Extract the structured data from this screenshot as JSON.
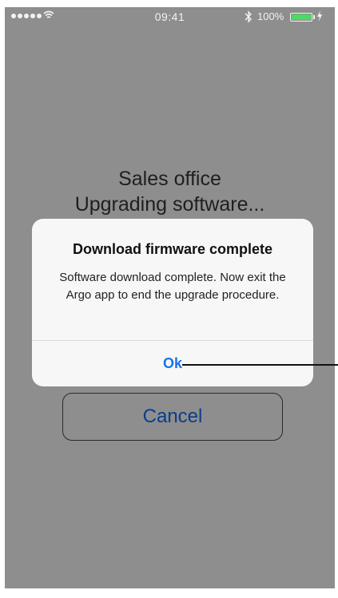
{
  "status_bar": {
    "time": "09:41",
    "battery_percent": "100%",
    "battery_level": 1.0,
    "signal_dots": 5,
    "icons": [
      "signal-icon",
      "wifi-icon",
      "bluetooth-icon",
      "battery-icon",
      "charging-icon"
    ]
  },
  "screen": {
    "heading_line1": "Sales office",
    "heading_line2": "Upgrading software...",
    "cancel_label": "Cancel",
    "background_color": "#8e8e8e"
  },
  "alert": {
    "title": "Download firmware complete",
    "message": "Software download complete. Now exit the Argo app to end the upgrade procedure.",
    "ok_label": "Ok",
    "accent_color": "#1a73e8"
  }
}
